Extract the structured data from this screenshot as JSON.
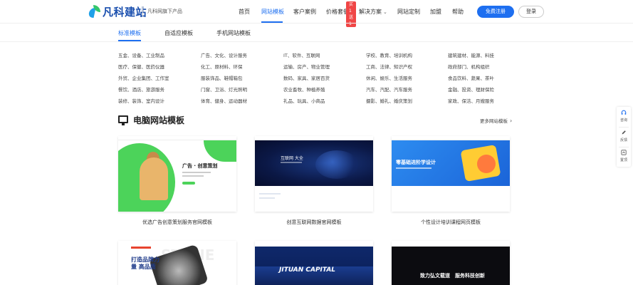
{
  "header": {
    "logo_text": "凡科建站",
    "logo_sub": "凡科网旗下产品",
    "nav": [
      {
        "label": "首页"
      },
      {
        "label": "网站模板"
      },
      {
        "label": "客户案例"
      },
      {
        "label": "价格套餐"
      },
      {
        "label": "解决方案"
      },
      {
        "label": "网站定制"
      },
      {
        "label": "加盟"
      },
      {
        "label": "帮助"
      }
    ],
    "badge": "买1送1",
    "register": "免费注册",
    "login": "登录",
    "accent": "#1e6ff0"
  },
  "subtabs": [
    {
      "label": "标准模板"
    },
    {
      "label": "自适应模板"
    },
    {
      "label": "手机网站模板"
    }
  ],
  "categories": [
    [
      "五金、设备、工业制品",
      "广告、文化、设计服务",
      "IT、软件、互联网",
      "学校、教育、培训机构",
      "建筑建材、能源、料挂"
    ],
    [
      "医疗、保健、医药仪器",
      "化工、原材料、环保",
      "运输、房产、物业管理",
      "工商、法律、知识产权",
      "政府部门、机构组织"
    ],
    [
      "外贸、企业集团、工作室",
      "服装饰品、鞋帽箱包",
      "数码、家具、家居百货",
      "休闲、娱乐、生活服务",
      "食品饮料、蔬果、茶叶"
    ],
    [
      "餐饮、酒店、旅游服务",
      "门窗、卫浴、灯光照明",
      "农业畜牧、种植养殖",
      "汽车、汽配、汽车服务",
      "金融、投资、理财保险"
    ],
    [
      "装修、装饰、室内设计",
      "体育、健身、运动器材",
      "礼品、玩具、小商品",
      "摄影、婚礼、婚庆策划",
      "家政、保洁、月嫂服务"
    ]
  ],
  "section": {
    "title": "电脑网站模板",
    "more": "更多网站模板",
    "icon": "monitor-icon"
  },
  "cards": [
    {
      "caption": "优选广告创意策划服务官网模板",
      "banner_title": "广告 · 创意策划"
    },
    {
      "caption": "创意互联网数据官网模板",
      "banner_title": "互联网 大全"
    },
    {
      "caption": "个性设计培训课程网页模板",
      "banner_title": "零基础进阶学设计"
    }
  ],
  "cards_row2": [
    {
      "banner_title": "打造品牌力量 高品质",
      "big_text": "STONE"
    },
    {
      "banner_title": "JITUAN CAPITAL"
    },
    {
      "banner_title": "致力弘文载道　服务科技创新"
    }
  ],
  "sidebar": [
    {
      "label": "咨询",
      "icon": "headset-icon"
    },
    {
      "label": "反馈",
      "icon": "pencil-icon"
    },
    {
      "label": "置顶",
      "icon": "top-icon"
    }
  ]
}
